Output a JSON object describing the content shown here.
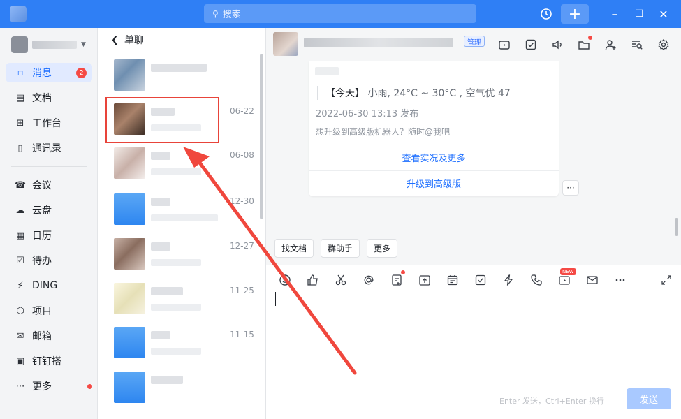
{
  "search": {
    "placeholder": "搜索"
  },
  "nav": {
    "items": [
      {
        "label": "消息",
        "icon": "message-icon",
        "badge": "2"
      },
      {
        "label": "文档",
        "icon": "document-icon"
      },
      {
        "label": "工作台",
        "icon": "workbench-icon"
      },
      {
        "label": "通讯录",
        "icon": "contacts-icon"
      },
      {
        "label": "会议",
        "icon": "meeting-icon"
      },
      {
        "label": "云盘",
        "icon": "cloud-drive-icon"
      },
      {
        "label": "日历",
        "icon": "calendar-icon"
      },
      {
        "label": "待办",
        "icon": "todo-icon"
      },
      {
        "label": "DING",
        "icon": "ding-icon"
      },
      {
        "label": "项目",
        "icon": "project-icon"
      },
      {
        "label": "邮箱",
        "icon": "mail-icon"
      },
      {
        "label": "钉钉搭",
        "icon": "builder-icon"
      },
      {
        "label": "更多",
        "icon": "more-icon"
      }
    ]
  },
  "list": {
    "title": "单聊",
    "dates": [
      "06-22",
      "06-08",
      "12-30",
      "12-27",
      "11-25",
      "11-15"
    ]
  },
  "chat": {
    "admin_tag": "管理",
    "card": {
      "weather_prefix": "【今天】",
      "weather_text": "小雨, 24°C ~ 30°C , 空气优 47",
      "published": "2022-06-30 13:13 发布",
      "tip": "想升级到高级版机器人？随时@我吧",
      "link1": "查看实况及更多",
      "link2": "升级到高级版"
    },
    "more": "···",
    "quick": [
      "找文档",
      "群助手",
      "更多"
    ],
    "new_tag": "NEW",
    "send_hint": "Enter 发送，Ctrl+Enter 换行",
    "send_label": "发送"
  },
  "colors": {
    "accent": "#2f7ff5",
    "highlight": "#e8443a"
  }
}
